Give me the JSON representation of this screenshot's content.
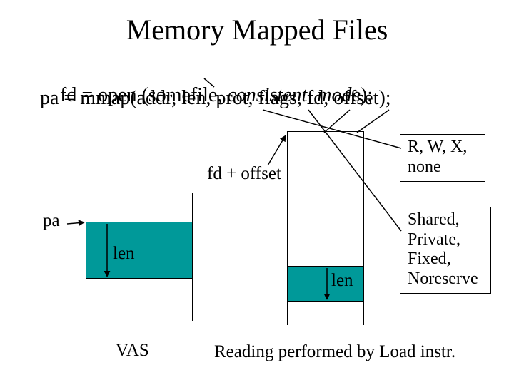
{
  "title": "Memory Mapped Files",
  "code": {
    "line1_pre": "fd = open (somefile, ",
    "line1_italic": "consistent_mode",
    "line1_post": ");",
    "line2": "pa = mmap(addr, len, prot, flags, fd, offset);"
  },
  "labels": {
    "fd_offset": "fd + offset",
    "pa": "pa",
    "len_left": "len",
    "len_right": "len",
    "vas": "VAS",
    "reading": "Reading performed by Load instr."
  },
  "callouts": {
    "prot": "R, W, X, none",
    "flags": "Shared, Private, Fixed, Noreserve"
  },
  "colors": {
    "mapped_region": "#009999",
    "border": "#000000",
    "background": "#ffffff"
  }
}
